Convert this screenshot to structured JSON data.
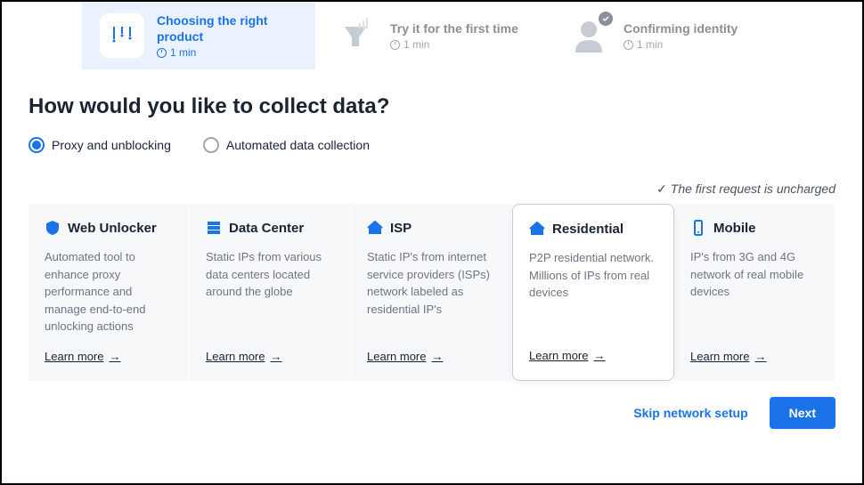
{
  "steps": [
    {
      "title": "Choosing the right product",
      "time": "1 min",
      "active": true
    },
    {
      "title": "Try it for the first time",
      "time": "1 min",
      "active": false
    },
    {
      "title": "Confirming identity",
      "time": "1 min",
      "active": false
    }
  ],
  "heading": "How would you like to collect data?",
  "radios": [
    {
      "label": "Proxy and unblocking",
      "selected": true
    },
    {
      "label": "Automated data collection",
      "selected": false
    }
  ],
  "note": "The first request is uncharged",
  "cards": [
    {
      "icon": "shield",
      "title": "Web Unlocker",
      "desc": "Automated tool to enhance proxy performance and manage end-to-end unlocking actions",
      "learn": "Learn more",
      "selected": false
    },
    {
      "icon": "server",
      "title": "Data Center",
      "desc": "Static IPs from various data centers located around the globe",
      "learn": "Learn more",
      "selected": false
    },
    {
      "icon": "house",
      "title": "ISP",
      "desc": "Static IP's from internet service providers (ISPs) network labeled as residential IP's",
      "learn": "Learn more",
      "selected": false
    },
    {
      "icon": "house",
      "title": "Residential",
      "desc": "P2P residential network. Millions of IPs from real devices",
      "learn": "Learn more",
      "selected": true
    },
    {
      "icon": "mobile",
      "title": "Mobile",
      "desc": "IP's from 3G and 4G network of real mobile devices",
      "learn": "Learn more",
      "selected": false
    }
  ],
  "footer": {
    "skip": "Skip network setup",
    "next": "Next"
  }
}
